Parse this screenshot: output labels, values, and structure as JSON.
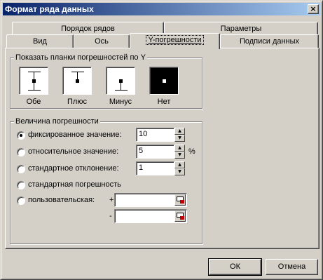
{
  "window": {
    "title": "Формат ряда данных",
    "close_glyph": "×"
  },
  "tabs": {
    "row1": [
      "Порядок рядов",
      "Параметры"
    ],
    "row2": [
      "Вид",
      "Ось",
      "Y-погрешности",
      "Подписи данных"
    ],
    "active": "Y-погрешности"
  },
  "display_group": {
    "legend": "Показать планки погрешностей по Y",
    "options": [
      {
        "label": "Обе",
        "icon": "both-error-bars-icon"
      },
      {
        "label": "Плюс",
        "icon": "plus-error-bar-icon"
      },
      {
        "label": "Минус",
        "icon": "minus-error-bar-icon"
      },
      {
        "label": "Нет",
        "icon": "no-error-bars-icon"
      }
    ],
    "selected": "Нет"
  },
  "amount_group": {
    "legend": "Величина погрешности",
    "fixed_label": "фиксированное значение:",
    "fixed_value": "10",
    "percent_label": "относительное значение:",
    "percent_value": "5",
    "percent_unit": "%",
    "stddev_label": "стандартное отклонение:",
    "stddev_value": "1",
    "stderr_label": "стандартная погрешность",
    "custom_label": "пользовательская:",
    "custom_plus_sign": "+",
    "custom_minus_sign": "-",
    "custom_plus_value": "",
    "custom_minus_value": "",
    "selected": "fixed"
  },
  "buttons": {
    "ok": "ОК",
    "cancel": "Отмена"
  }
}
